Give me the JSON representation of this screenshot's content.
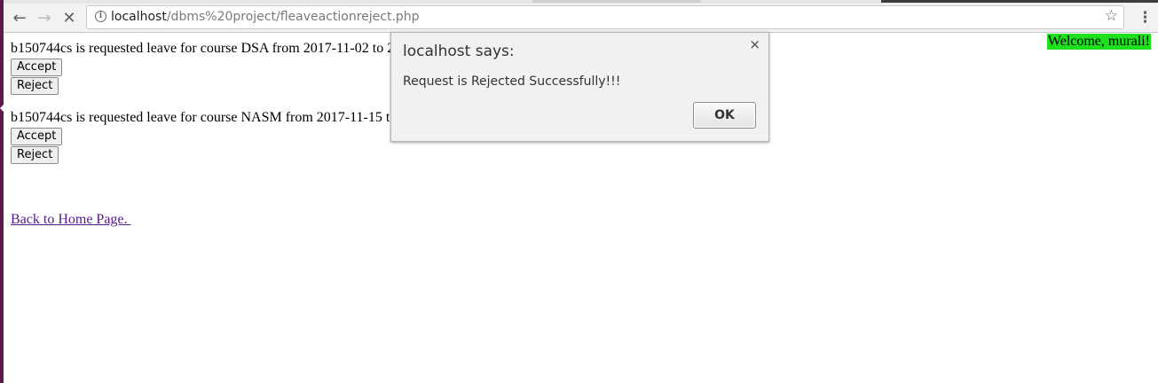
{
  "browser": {
    "url_host": "localhost",
    "url_path": "/dbms%20project/fleaveactionreject.php",
    "back_icon": "←",
    "forward_icon": "→",
    "stop_icon": "✕",
    "info_icon": "i",
    "star_icon": "☆",
    "menu_icon": "⋮"
  },
  "page": {
    "welcome": "Welcome, murali!",
    "requests": [
      {
        "text": "b150744cs is requested leave for course DSA from 2017-11-02 to 2",
        "accept_label": "Accept",
        "reject_label": "Reject"
      },
      {
        "text": "b150744cs is requested leave for course NASM from 2017-11-15 to",
        "accept_label": "Accept",
        "reject_label": "Reject"
      }
    ],
    "back_link": "Back to Home Page. "
  },
  "dialog": {
    "title": "localhost says:",
    "close_icon": "×",
    "message": "Request is Rejected Successfully!!!",
    "ok_label": "OK"
  },
  "colors": {
    "welcome_bg": "#1fe01f",
    "link": "#551a8b",
    "desktop_strip": "#5a1b4a"
  }
}
